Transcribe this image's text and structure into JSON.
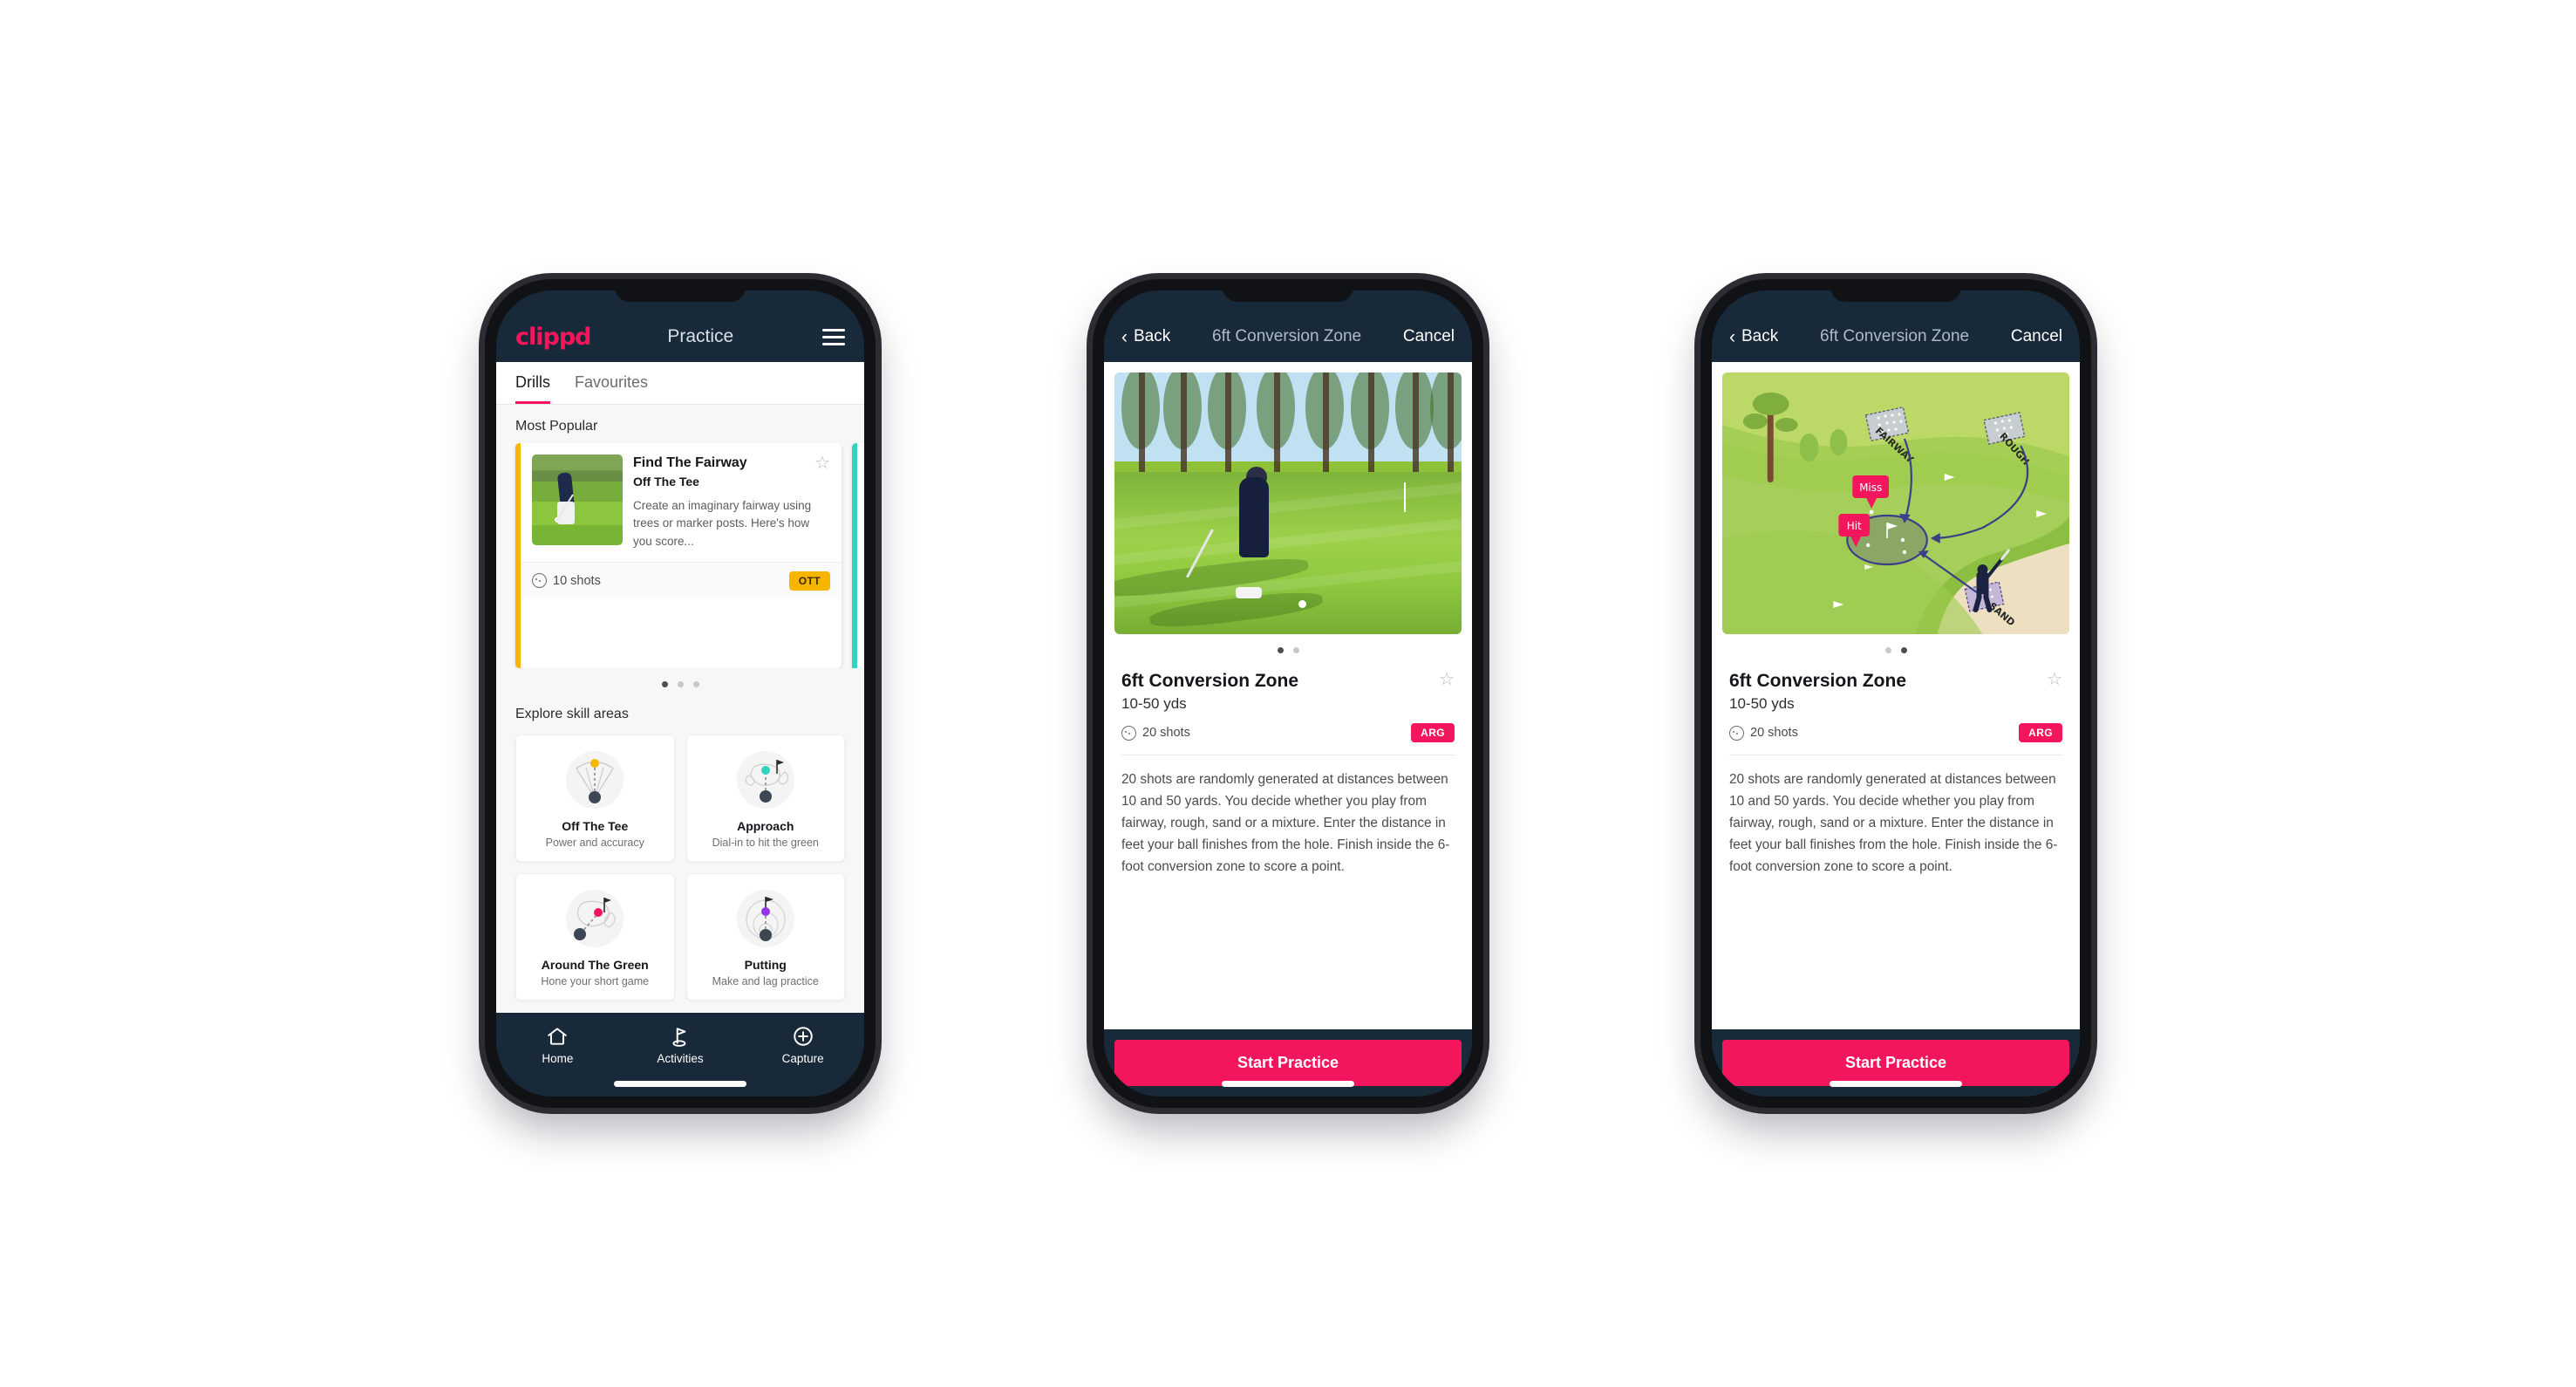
{
  "phone1": {
    "appbar": {
      "logo": "clippd",
      "title": "Practice",
      "menu_icon": "hamburger-icon"
    },
    "tabs": [
      {
        "label": "Drills",
        "active": true
      },
      {
        "label": "Favourites",
        "active": false
      }
    ],
    "most_popular": {
      "section_label": "Most Popular",
      "card": {
        "title": "Find The Fairway",
        "subtitle": "Off The Tee",
        "description": "Create an imaginary fairway using trees or marker posts. Here's how you score...",
        "shots": "10 shots",
        "badge": "OTT",
        "badge_color": "#f7b500",
        "accent_color": "#f7b500",
        "star_icon": "star-outline-icon",
        "shots_icon": "golf-ball-icon"
      },
      "dots": [
        true,
        false,
        false
      ]
    },
    "explore": {
      "section_label": "Explore skill areas",
      "cards": [
        {
          "name": "Off The Tee",
          "desc": "Power and accuracy",
          "icon": "tee-fan-icon",
          "dot_color": "#f7b500"
        },
        {
          "name": "Approach",
          "desc": "Dial-in to hit the green",
          "icon": "approach-green-icon",
          "dot_color": "#2dd4bf"
        },
        {
          "name": "Around The Green",
          "desc": "Hone your short game",
          "icon": "chip-green-icon",
          "dot_color": "#f4165c"
        },
        {
          "name": "Putting",
          "desc": "Make and lag practice",
          "icon": "putting-rings-icon",
          "dot_color": "#9333ea"
        }
      ]
    },
    "tabbar": [
      {
        "label": "Home",
        "icon": "home-icon",
        "active": false
      },
      {
        "label": "Activities",
        "icon": "golf-flag-icon",
        "active": true
      },
      {
        "label": "Capture",
        "icon": "plus-circle-icon",
        "active": false
      }
    ]
  },
  "phone2": {
    "navbar": {
      "back": "Back",
      "title": "6ft Conversion Zone",
      "cancel": "Cancel",
      "back_icon": "chevron-left-icon"
    },
    "media": {
      "type": "photo",
      "alt": "golfer-putting-photo"
    },
    "dots": [
      true,
      false
    ],
    "detail": {
      "title": "6ft Conversion Zone",
      "subtitle": "10-50 yds",
      "shots": "20 shots",
      "badge": "ARG",
      "badge_color": "#f4165c",
      "star_icon": "star-outline-icon",
      "shots_icon": "golf-ball-icon",
      "description": "20 shots are randomly generated at distances between 10 and 50 yards. You decide whether you play from fairway, rough, sand or a mixture. Enter the distance in feet your ball finishes from the hole. Finish inside the 6-foot conversion zone to score a point."
    },
    "cta": "Start Practice"
  },
  "phone3": {
    "navbar": {
      "back": "Back",
      "title": "6ft Conversion Zone",
      "cancel": "Cancel",
      "back_icon": "chevron-left-icon"
    },
    "media": {
      "type": "illustration",
      "alt": "golf-course-diagram",
      "labels": {
        "fairway": "FAIRWAY",
        "rough": "ROUGH",
        "sand": "SAND",
        "miss": "Miss",
        "hit": "Hit"
      }
    },
    "dots": [
      false,
      true
    ],
    "detail": {
      "title": "6ft Conversion Zone",
      "subtitle": "10-50 yds",
      "shots": "20 shots",
      "badge": "ARG",
      "badge_color": "#f4165c",
      "star_icon": "star-outline-icon",
      "shots_icon": "golf-ball-icon",
      "description": "20 shots are randomly generated at distances between 10 and 50 yards. You decide whether you play from fairway, rough, sand or a mixture. Enter the distance in feet your ball finishes from the hole. Finish inside the 6-foot conversion zone to score a point."
    },
    "cta": "Start Practice"
  }
}
